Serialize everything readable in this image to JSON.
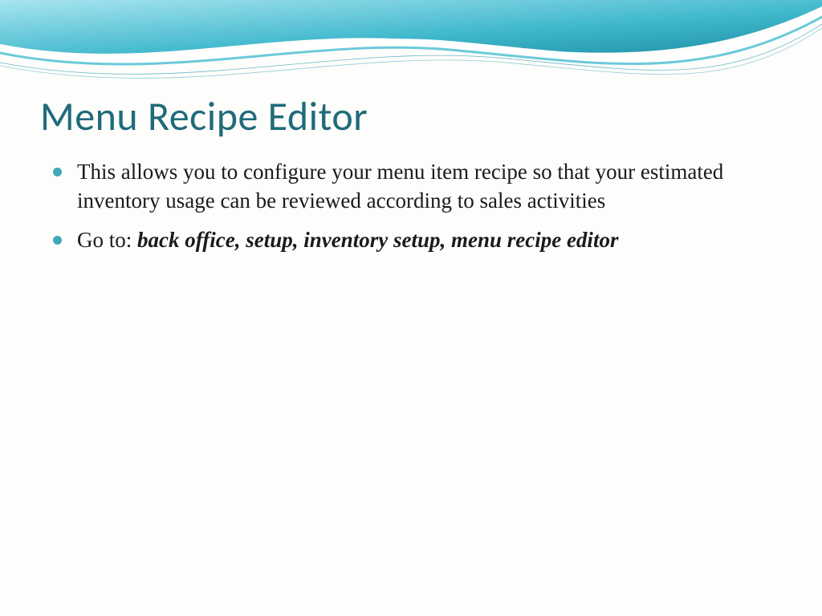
{
  "slide": {
    "title": "Menu Recipe Editor",
    "bullets": [
      {
        "text": "This allows you to configure your menu item recipe so that your estimated inventory usage can be reviewed according to sales activities",
        "bold_part": ""
      },
      {
        "text": "Go to: ",
        "bold_part": "back office, setup, inventory setup, menu recipe editor"
      }
    ]
  },
  "theme": {
    "accent": "#3fa9b8",
    "title_color": "#1f6b7a",
    "wave_gradient_start": "#7fd4e6",
    "wave_gradient_end": "#2aa3b8"
  }
}
